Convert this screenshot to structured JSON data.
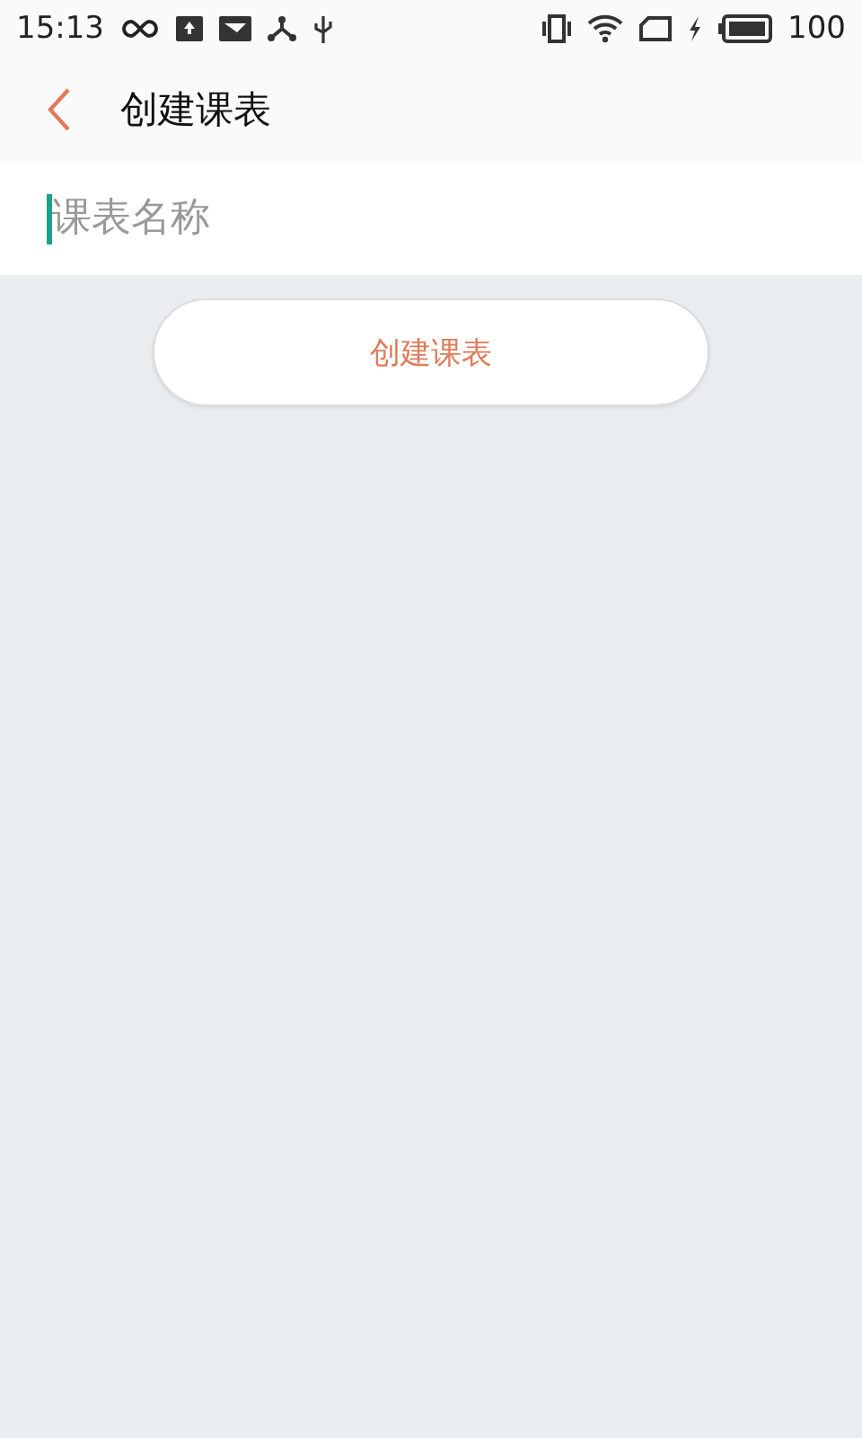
{
  "status_bar": {
    "time": "15:13",
    "battery": "100"
  },
  "header": {
    "title": "创建课表"
  },
  "name_field": {
    "placeholder": "课表名称"
  },
  "create_button": {
    "label": "创建课表"
  }
}
